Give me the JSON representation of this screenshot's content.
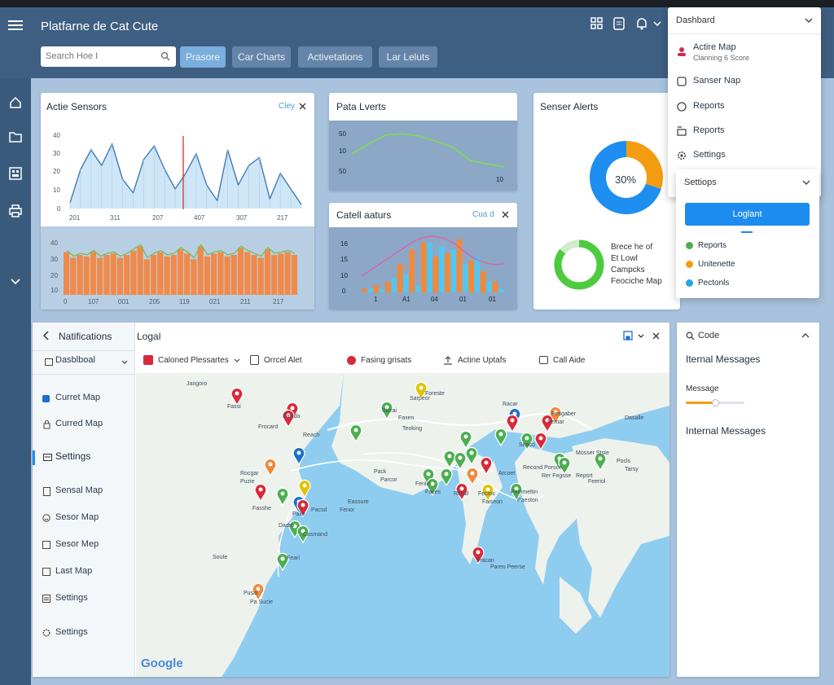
{
  "app": {
    "title": "Platfarne de Cat Cute"
  },
  "search": {
    "placeholder": "Search Hoe I"
  },
  "toolbar": {
    "buttons": [
      "Prasore",
      "Car Charts",
      "Activetations",
      "Lar Leluts"
    ]
  },
  "panels": {
    "active_sensors": {
      "title": "Actie Sensors",
      "action": "Cley",
      "y_ticks": [
        "0",
        "10",
        "20",
        "30",
        "40"
      ],
      "x_ticks": [
        "201",
        "311",
        "207",
        "407",
        "307",
        "217"
      ],
      "bar_x_ticks": [
        "0",
        "107",
        "001",
        "205",
        "119",
        "021",
        "211",
        "217"
      ],
      "bar_y_ticks": [
        "0",
        "10",
        "20",
        "30",
        "40"
      ]
    },
    "data_alerts": {
      "title": "Pata Lverts",
      "y_ticks": [
        "50",
        "10",
        "50"
      ],
      "x_ticks": [
        "10"
      ]
    },
    "detail_status": {
      "title": "Catell aaturs",
      "action": "Cua d",
      "y_ticks": [
        "0",
        "10",
        "15",
        "16"
      ],
      "x_ticks": [
        "1",
        "A1",
        "04",
        "01",
        "01"
      ]
    },
    "sensor_alerts": {
      "title": "Senser Alerts",
      "pie_label": "30%",
      "ring_lines": [
        "Brece he of",
        "Et Lowl",
        "Campcks",
        "Feociche Map"
      ]
    }
  },
  "dropdown": {
    "header": "Dashbard",
    "items": [
      {
        "label": "Actire Map",
        "sub": "Clanning 6 Score",
        "icon": "user-icon"
      },
      {
        "label": "Sanser Nap",
        "icon": "box-icon"
      },
      {
        "label": "Reports",
        "icon": "circle-icon"
      },
      {
        "label": "Reports",
        "icon": "grid-icon"
      },
      {
        "label": "Settings",
        "icon": "gear-icon"
      }
    ],
    "settings_header": "Settiops",
    "logout": "Loglant",
    "legend": [
      {
        "label": "Reports",
        "color": "#4caf50"
      },
      {
        "label": "Unitenette",
        "color": "#f39c12"
      },
      {
        "label": "Pectonls",
        "color": "#26a5e4"
      }
    ]
  },
  "notifications": {
    "title": "Natifications",
    "dashboard": "Dasblboal",
    "items": [
      "Curret Map",
      "Curred Map",
      "Settings",
      "Sensal Map",
      "Sesor Map",
      "Sesor Mep",
      "Last Map",
      "Settings",
      "Settings"
    ]
  },
  "map": {
    "title": "Logal",
    "filters": [
      "Caloned Plessartes",
      "Orrcel Alet",
      "Fasing grisats",
      "Actine Uptafs",
      "Call Aide"
    ],
    "google": "Google",
    "place_labels": [
      "Jangoro",
      "Fassi",
      "Paxido",
      "Frocard",
      "Sierai",
      "Sarpeor",
      "Reach",
      "Rocgar",
      "Puzie",
      "Fasshe",
      "Palle",
      "Dadro",
      "Casmand",
      "Fearl",
      "Pusal",
      "Pa Sucie",
      "Soute",
      "Pack",
      "Parcor",
      "Fenlin",
      "Faces",
      "Rerall",
      "Fectoc",
      "Faiseon",
      "Pemmeltin",
      "Paeston",
      "Arcoet",
      "Pemar",
      "Pesgaber",
      "Seaco",
      "Mosser Stste",
      "Pocls",
      "Tarsy",
      "Fracan",
      "Pareo Peerse",
      "Recond Porsce",
      "Rer Fegsse",
      "Repsrt",
      "Feeriol",
      "Faxen",
      "Teoking",
      "Pacsd",
      "Fenor",
      "Eassure",
      "Racar",
      "Foreste",
      "Dasalle"
    ]
  },
  "messages": {
    "search": "Code",
    "internal1": "Iternal Messages",
    "message_label": "Message",
    "slider_value": 0.5,
    "internal2": "Internal Messages"
  },
  "chart_data": [
    {
      "type": "area",
      "title": "Actie Sensors",
      "ylim": [
        0,
        40
      ],
      "x": [
        "201",
        "311",
        "207",
        "407",
        "307",
        "217"
      ],
      "values": [
        3,
        20,
        30,
        22,
        33,
        15,
        8,
        25,
        32,
        20,
        10,
        18,
        28,
        12,
        4,
        30,
        12,
        22,
        26,
        5,
        18,
        10,
        2
      ]
    },
    {
      "type": "bar",
      "title": "Actie Sensors",
      "ylim": [
        0,
        40
      ],
      "values": [
        30,
        26,
        28,
        27,
        30,
        26,
        28,
        29,
        26,
        28,
        31,
        34,
        25,
        28,
        30,
        27,
        28,
        32,
        29,
        25,
        34,
        27,
        29,
        30,
        27,
        28,
        33,
        30,
        28,
        26,
        32,
        28,
        29,
        30,
        28
      ]
    },
    {
      "type": "line",
      "title": "Pata Lverts",
      "values": [
        20,
        28,
        35,
        36,
        34,
        30,
        25,
        15,
        12,
        10
      ]
    },
    {
      "type": "bar",
      "title": "Catell aaturs",
      "categories": [
        "1",
        "A1",
        "04",
        "01",
        "01"
      ],
      "series": [
        {
          "values": [
            1,
            2,
            3,
            8,
            12,
            14,
            10,
            11,
            15,
            9,
            6,
            3
          ]
        },
        {
          "values": [
            1,
            1,
            4,
            5,
            2,
            14,
            13,
            12,
            8,
            10,
            3,
            1
          ]
        }
      ]
    },
    {
      "type": "pie",
      "title": "Senser Alerts",
      "values": [
        30,
        70
      ],
      "labels": [
        "30%",
        ""
      ]
    }
  ]
}
